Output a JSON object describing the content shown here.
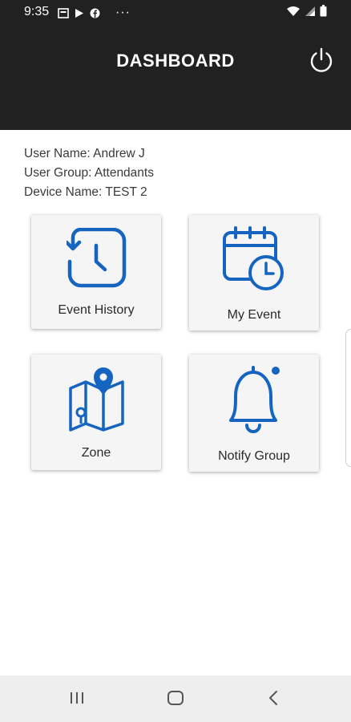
{
  "status_bar": {
    "time": "9:35",
    "icons_left": [
      "gallery-icon",
      "play-store-icon",
      "facebook-icon",
      "more-icon"
    ],
    "more": "···",
    "icons_right": [
      "wifi-icon",
      "signal-icon",
      "battery-icon"
    ]
  },
  "header": {
    "title": "DASHBOARD",
    "power_icon": "power-icon"
  },
  "user_info": {
    "user_name": "User Name: Andrew J",
    "user_group": "User Group: Attendants",
    "device_name": "Device Name: TEST 2"
  },
  "tiles": [
    {
      "label": "Event History",
      "icon": "history-clock-icon"
    },
    {
      "label": "My Event",
      "icon": "calendar-clock-icon"
    },
    {
      "label": "Zone",
      "icon": "map-pin-icon"
    },
    {
      "label": "Notify Group",
      "icon": "bell-icon"
    }
  ],
  "nav_bar": {
    "buttons": [
      "recents-icon",
      "home-icon",
      "back-icon"
    ]
  },
  "colors": {
    "header_bg": "#212121",
    "accent": "#1565c0",
    "tile_bg": "#f5f5f5",
    "nav_bg": "#eeeeee"
  }
}
